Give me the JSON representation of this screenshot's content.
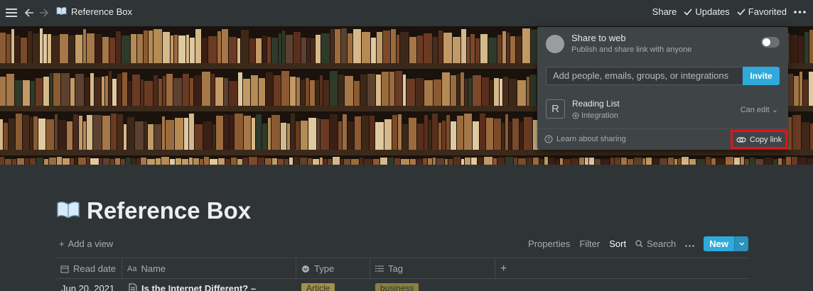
{
  "topbar": {
    "page_title": "Reference Box",
    "share_label": "Share",
    "updates_label": "Updates",
    "favorited_label": "Favorited"
  },
  "share_popup": {
    "share_to_web_title": "Share to web",
    "share_to_web_sub": "Publish and share link with anyone",
    "invite_placeholder": "Add people, emails, groups, or integrations",
    "invite_button": "Invite",
    "member_avatar": "R",
    "member_name": "Reading List",
    "member_type": "Integration",
    "member_permission": "Can edit",
    "learn_label": "Learn about sharing",
    "copy_link_label": "Copy link",
    "highlight_color": "#e0141b"
  },
  "page": {
    "title": "Reference Box",
    "add_view_label": "Add a view",
    "properties_label": "Properties",
    "filter_label": "Filter",
    "sort_label": "Sort",
    "search_label": "Search",
    "new_label": "New"
  },
  "table": {
    "columns": [
      "Read date",
      "Name",
      "Type",
      "Tag"
    ],
    "first_row": {
      "read_date": "Jun 20, 2021",
      "name": "Is the Internet Different? –",
      "type": "Article",
      "tag": "business"
    }
  },
  "colors": {
    "accent": "#2eaadc",
    "background": "#2f3437",
    "tag_article": "#a2904a",
    "tag_business": "#8a7f3c"
  }
}
